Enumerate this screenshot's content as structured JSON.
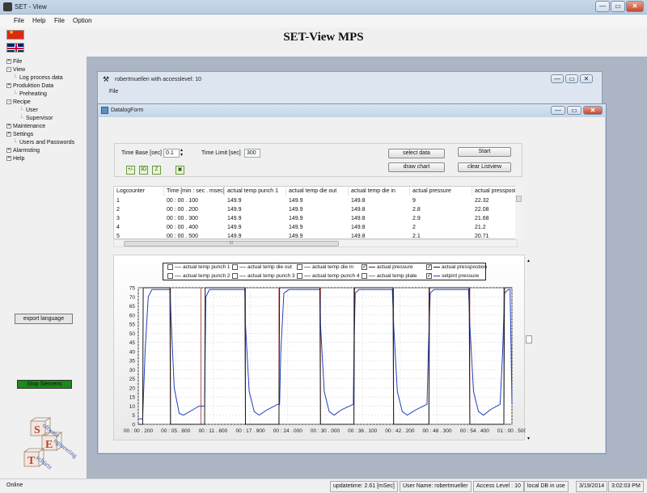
{
  "window": {
    "title": "SET - View",
    "controls": [
      "—",
      "▭",
      "✕"
    ]
  },
  "menubar": {
    "items": [
      "File",
      "Help",
      "File",
      "Option"
    ]
  },
  "app_title": "SET-View MPS",
  "tree": [
    {
      "label": "File",
      "level": 0,
      "box": "+"
    },
    {
      "label": "View",
      "level": 0,
      "box": "-"
    },
    {
      "label": "Log process data",
      "level": 1
    },
    {
      "label": "Produktion Data",
      "level": 0,
      "box": "+"
    },
    {
      "label": "Preheating",
      "level": 1
    },
    {
      "label": "Recipe",
      "level": 0,
      "box": "-"
    },
    {
      "label": "User",
      "level": 2
    },
    {
      "label": "Supervisor",
      "level": 2
    },
    {
      "label": "Maintenance",
      "level": 0,
      "box": "+"
    },
    {
      "label": "Settings",
      "level": 0,
      "box": "+"
    },
    {
      "label": "Users and Passwords",
      "level": 1
    },
    {
      "label": "Alarmsting",
      "level": 0,
      "box": "+"
    },
    {
      "label": "Help",
      "level": 0,
      "box": "+"
    }
  ],
  "export_button": "export language",
  "stop_button": "Stop Siemens",
  "logo": {
    "letters": [
      "S",
      "E",
      "T"
    ],
    "words": [
      "oftware",
      "ngineering",
      "schürtz"
    ]
  },
  "child_window": {
    "title": "robertmuellen  with accesslevel: 10",
    "menu": "File",
    "controls": [
      "—",
      "▭",
      "✕"
    ]
  },
  "datalog": {
    "title": "DatalogForm",
    "controls": [
      "—",
      "▭",
      "✕"
    ],
    "time_base_label": "Time Base [sec]",
    "time_base_value": "0.1",
    "time_limit_label": "Time Limit [sec]",
    "time_limit_value": "300",
    "buttons": {
      "select_data": "select data",
      "start": "Start",
      "draw_chart": "draw chart",
      "clear_listview": "clear Listview"
    },
    "tool_icons": [
      "+/-",
      "3D",
      "Z",
      "▣"
    ],
    "columns": [
      "Logcounter",
      "Time [min : sec . msec]",
      "actual temp punch 1",
      "actual temp die out",
      "actual temp die in",
      "actual pressure",
      "actual presspost"
    ],
    "rows": [
      [
        "1",
        "00 : 00 . 100",
        "149.9",
        "149.9",
        "149.8",
        "9",
        "22.32"
      ],
      [
        "2",
        "00 : 00 . 200",
        "149.9",
        "149.9",
        "149.8",
        "2.8",
        "22.08"
      ],
      [
        "3",
        "00 : 00 . 300",
        "149.9",
        "149.9",
        "149.8",
        "2.9",
        "21.68"
      ],
      [
        "4",
        "00 : 00 . 400",
        "149.9",
        "149.9",
        "149.8",
        "2",
        "21.2"
      ],
      [
        "5",
        "00 : 00 . 500",
        "149.9",
        "149.9",
        "149.8",
        "2.1",
        "20.71"
      ]
    ],
    "scroll_glyph": "III",
    "legend": [
      {
        "label": "actual temp punch 1",
        "checked": false,
        "color": "#888888"
      },
      {
        "label": "actual temp die out",
        "checked": false,
        "color": "#888888"
      },
      {
        "label": "actual temp die in",
        "checked": false,
        "color": "#888888"
      },
      {
        "label": "actual pressure",
        "checked": true,
        "color": "#7a1a1a"
      },
      {
        "label": "actual presspostion",
        "checked": true,
        "color": "#1a1a1a"
      },
      {
        "label": "actual temp punch 2",
        "checked": false,
        "color": "#888888"
      },
      {
        "label": "actual temp punch 3",
        "checked": false,
        "color": "#888888"
      },
      {
        "label": "actual temp punch 4",
        "checked": false,
        "color": "#888888"
      },
      {
        "label": "actual temp plate",
        "checked": false,
        "color": "#888888"
      },
      {
        "label": "setpint pressure",
        "checked": true,
        "color": "#2040c0"
      }
    ]
  },
  "chart_data": {
    "type": "line",
    "ylim": [
      0,
      75
    ],
    "yticks": [
      0,
      5,
      10,
      15,
      20,
      25,
      30,
      35,
      40,
      45,
      50,
      55,
      60,
      65,
      70,
      75
    ],
    "xticks": [
      "00 : 00 . 200",
      "00 : 05 . 800",
      "00 : 11 . 800",
      "00 : 17 . 900",
      "00 : 24 . 000",
      "00 : 30 . 000",
      "00 : 36 . 100",
      "00 : 42 . 200",
      "00 : 48 . 300",
      "00 : 54 . 400",
      "01 : 00 . 500"
    ],
    "xlim_seconds": [
      0.2,
      60.5
    ],
    "grid": true,
    "series": [
      {
        "name": "setpint pressure",
        "color": "#2040c0",
        "x": [
          0.2,
          0.9,
          1.3,
          1.8,
          2.4,
          3.0,
          5.3,
          5.5,
          6.0,
          6.8,
          7.5,
          9.0,
          10.0,
          10.9,
          11.0,
          11.1,
          11.7,
          12.4,
          12.8,
          13.2,
          17.4,
          17.5,
          18.1,
          18.9,
          19.7,
          21.0,
          22.7,
          23.0,
          23.2,
          23.7,
          24.5,
          25.0,
          29.5,
          29.6,
          30.2,
          31.0,
          31.8,
          33.0,
          34.9,
          35.0,
          35.2,
          35.8,
          36.6,
          37.1,
          41.2,
          41.4,
          42.0,
          42.8,
          43.6,
          45.0,
          46.8,
          47.0,
          47.3,
          47.9,
          48.6,
          49.1,
          53.5,
          53.7,
          54.3,
          55.1,
          55.9,
          57.0,
          58.6,
          59.0,
          59.3,
          59.9,
          60.2,
          60.5
        ],
        "y": [
          3,
          3,
          40,
          70,
          74,
          74,
          74,
          58,
          20,
          6,
          5,
          8,
          10,
          10,
          40,
          70,
          74,
          74,
          74,
          74,
          74,
          55,
          18,
          7,
          5,
          8,
          11,
          11,
          40,
          72,
          74,
          74,
          74,
          55,
          18,
          7,
          5,
          8,
          11,
          40,
          72,
          74,
          74,
          74,
          74,
          55,
          18,
          7,
          5,
          8,
          11,
          40,
          72,
          74,
          74,
          74,
          74,
          55,
          18,
          7,
          5,
          8,
          11,
          40,
          72,
          74,
          74,
          12
        ]
      },
      {
        "name": "actual presspostion",
        "color": "#1a1a1a",
        "x": [
          0.2,
          0.9,
          1.0,
          1.4,
          5.3,
          5.4,
          10.9,
          11.0,
          11.2,
          17.4,
          17.5,
          22.9,
          23.0,
          23.2,
          29.5,
          29.6,
          35.0,
          35.1,
          35.3,
          41.3,
          41.4,
          47.1,
          47.2,
          47.4,
          53.6,
          53.7,
          59.2,
          59.3,
          59.5,
          60.5
        ],
        "y": [
          0,
          0,
          75,
          75,
          75,
          0,
          0,
          75,
          75,
          75,
          0,
          0,
          75,
          75,
          75,
          0,
          0,
          75,
          75,
          75,
          0,
          0,
          75,
          75,
          75,
          0,
          0,
          75,
          75,
          75
        ]
      }
    ],
    "markers_seconds": [
      5.4,
      10.3,
      17.5,
      22.9,
      29.6,
      35.0,
      41.4,
      47.1,
      53.7,
      59.2
    ]
  },
  "status": {
    "state": "Online",
    "update": "updatetime: 2.61 [mSec]",
    "user": "User Name: robertmueller",
    "access": "Access Level : 10",
    "db": "local DB in use",
    "date": "3/19/2014",
    "time": "3:02:03 PM"
  }
}
